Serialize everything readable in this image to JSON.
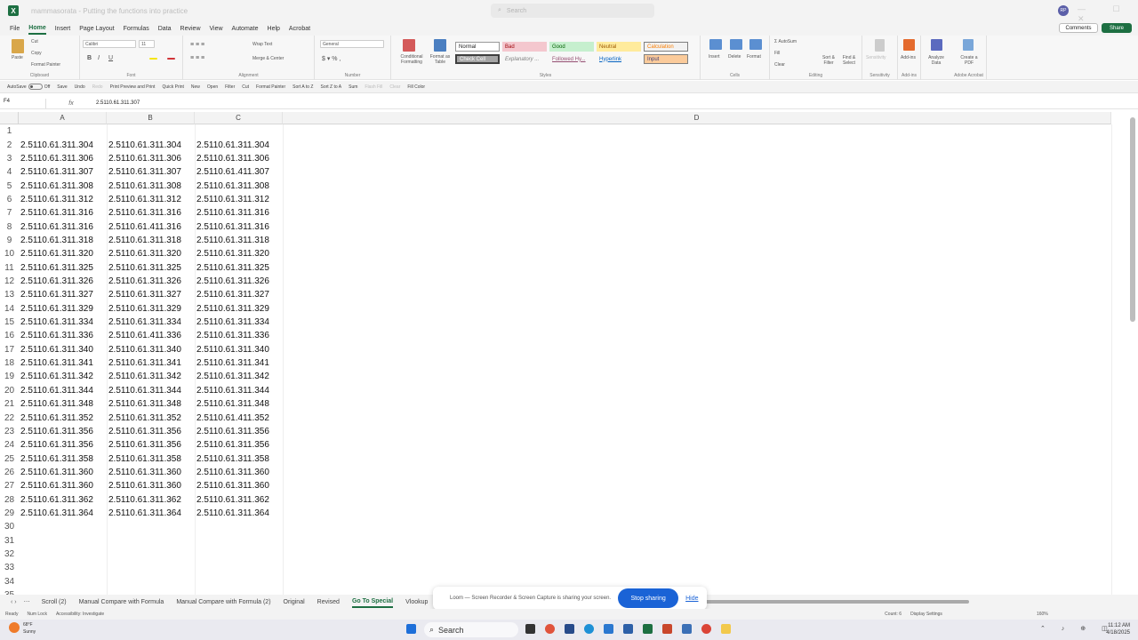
{
  "window": {
    "title": "mammasorata - Putting the functions into practice",
    "search_placeholder": "Search",
    "avatar": "RP",
    "controls": "— ☐ ✕"
  },
  "menu": {
    "items": [
      "File",
      "Home",
      "Insert",
      "Page Layout",
      "Formulas",
      "Data",
      "Review",
      "View",
      "Automate",
      "Help",
      "Acrobat"
    ],
    "comments": "Comments",
    "share": "Share"
  },
  "ribbon": {
    "clipboard": {
      "paste": "Paste",
      "cut": "Cut",
      "copy": "Copy",
      "format_painter": "Format Painter",
      "label": "Clipboard"
    },
    "font": {
      "name": "Calibri",
      "size": "11",
      "label": "Font"
    },
    "alignment": {
      "wrap": "Wrap Text",
      "merge": "Merge & Center",
      "label": "Alignment"
    },
    "number": {
      "format": "General",
      "label": "Number"
    },
    "styles": {
      "conditional": "Conditional Formatting",
      "format_table": "Format as Table",
      "normal": "Normal",
      "bad": "Bad",
      "good": "Good",
      "neutral": "Neutral",
      "calculation": "Calculation",
      "check_cell": "Check Cell",
      "explanatory": "Explanatory ...",
      "followed": "Followed Hy...",
      "hyperlink": "Hyperlink",
      "input": "Input",
      "label": "Styles"
    },
    "cells": {
      "insert": "Insert",
      "delete": "Delete",
      "format": "Format",
      "label": "Cells"
    },
    "editing": {
      "autosum": "AutoSum",
      "fill": "Fill",
      "clear": "Clear",
      "sort": "Sort & Filter",
      "find": "Find & Select",
      "label": "Editing"
    },
    "sensitivity": {
      "btn": "Sensitivity",
      "label": "Sensitivity"
    },
    "addins": {
      "btn": "Add-ins",
      "label": "Add-ins"
    },
    "analyze": {
      "btn": "Analyze Data"
    },
    "acrobat": {
      "btn": "Create a PDF",
      "label": "Adobe Acrobat"
    },
    "colors": {
      "bad": "#f4c7ce",
      "good": "#c6efce",
      "neutral": "#ffeb9c",
      "calc": "#f2f2f2",
      "input": "#fbcb9b"
    }
  },
  "qat": {
    "autosave": "AutoSave",
    "autosave_state": "Off",
    "items": [
      "Save",
      "Undo",
      "Redo",
      "Print Preview and Print",
      "Quick Print",
      "New",
      "Open",
      "Filter",
      "Cut",
      "Format Painter",
      "Sort A to Z",
      "Sort Z to A",
      "Sum",
      "Flash Fill",
      "Clear",
      "Fill Color"
    ],
    "dim_items": [
      "Redo",
      "Flash Fill",
      "Clear"
    ]
  },
  "formula_bar": {
    "name_box": "F4",
    "fx": "fx",
    "content": "2.5110.61.311.307"
  },
  "grid": {
    "columns": [
      "A",
      "B",
      "C",
      "D"
    ],
    "row_numbers": [
      "1",
      "2",
      "3",
      "4",
      "5",
      "6",
      "7",
      "8",
      "9",
      "10",
      "11",
      "12",
      "13",
      "14",
      "15",
      "16",
      "17",
      "18",
      "19",
      "20",
      "21",
      "22",
      "23",
      "24",
      "25",
      "26",
      "27",
      "28",
      "29",
      "30",
      "31",
      "32",
      "33",
      "34",
      "35"
    ],
    "rows": [
      [
        "2.5110.61.311.304",
        "2.5110.61.311.304",
        "2.5110.61.311.304"
      ],
      [
        "2.5110.61.311.306",
        "2.5110.61.311.306",
        "2.5110.61.311.306"
      ],
      [
        "2.5110.61.311.307",
        "2.5110.61.311.307",
        "2.5110.61.411.307"
      ],
      [
        "2.5110.61.311.308",
        "2.5110.61.311.308",
        "2.5110.61.311.308"
      ],
      [
        "2.5110.61.311.312",
        "2.5110.61.311.312",
        "2.5110.61.311.312"
      ],
      [
        "2.5110.61.311.316",
        "2.5110.61.311.316",
        "2.5110.61.311.316"
      ],
      [
        "2.5110.61.311.316",
        "2.5110.61.411.316",
        "2.5110.61.311.316"
      ],
      [
        "2.5110.61.311.318",
        "2.5110.61.311.318",
        "2.5110.61.311.318"
      ],
      [
        "2.5110.61.311.320",
        "2.5110.61.311.320",
        "2.5110.61.311.320"
      ],
      [
        "2.5110.61.311.325",
        "2.5110.61.311.325",
        "2.5110.61.311.325"
      ],
      [
        "2.5110.61.311.326",
        "2.5110.61.311.326",
        "2.5110.61.311.326"
      ],
      [
        "2.5110.61.311.327",
        "2.5110.61.311.327",
        "2.5110.61.311.327"
      ],
      [
        "2.5110.61.311.329",
        "2.5110.61.311.329",
        "2.5110.61.311.329"
      ],
      [
        "2.5110.61.311.334",
        "2.5110.61.311.334",
        "2.5110.61.311.334"
      ],
      [
        "2.5110.61.311.336",
        "2.5110.61.411.336",
        "2.5110.61.311.336"
      ],
      [
        "2.5110.61.311.340",
        "2.5110.61.311.340",
        "2.5110.61.311.340"
      ],
      [
        "2.5110.61.311.341",
        "2.5110.61.311.341",
        "2.5110.61.311.341"
      ],
      [
        "2.5110.61.311.342",
        "2.5110.61.311.342",
        "2.5110.61.311.342"
      ],
      [
        "2.5110.61.311.344",
        "2.5110.61.311.344",
        "2.5110.61.311.344"
      ],
      [
        "2.5110.61.311.348",
        "2.5110.61.311.348",
        "2.5110.61.311.348"
      ],
      [
        "2.5110.61.311.352",
        "2.5110.61.311.352",
        "2.5110.61.411.352"
      ],
      [
        "2.5110.61.311.356",
        "2.5110.61.311.356",
        "2.5110.61.311.356"
      ],
      [
        "2.5110.61.311.356",
        "2.5110.61.311.356",
        "2.5110.61.311.356"
      ],
      [
        "2.5110.61.311.358",
        "2.5110.61.311.358",
        "2.5110.61.311.358"
      ],
      [
        "2.5110.61.311.360",
        "2.5110.61.311.360",
        "2.5110.61.311.360"
      ],
      [
        "2.5110.61.311.360",
        "2.5110.61.311.360",
        "2.5110.61.311.360"
      ],
      [
        "2.5110.61.311.362",
        "2.5110.61.311.362",
        "2.5110.61.311.362"
      ],
      [
        "2.5110.61.311.364",
        "2.5110.61.311.364",
        "2.5110.61.311.364"
      ]
    ]
  },
  "sheet_tabs": {
    "items": [
      "Scroll (2)",
      "Manual Compare with Formula",
      "Manual Compare with Formula (2)",
      "Original",
      "Revised",
      "Go To Special",
      "Vlookup"
    ],
    "active": "Go To Special"
  },
  "share_popup": {
    "text": "Loom — Screen Recorder & Screen Capture is sharing your screen.",
    "stop": "Stop sharing",
    "hide": "Hide",
    "accent": "#1a63d6"
  },
  "status_bar": {
    "ready": "Ready",
    "num_lock": "Num Lock",
    "accessibility": "Accessibility: Investigate",
    "count": "Count: 6",
    "display": "Display Settings",
    "zoom": "160%"
  },
  "taskbar": {
    "weather_temp": "68°F",
    "weather_desc": "Sunny",
    "search": "Search",
    "time": "11:12 AM",
    "date": "4/18/2025"
  }
}
